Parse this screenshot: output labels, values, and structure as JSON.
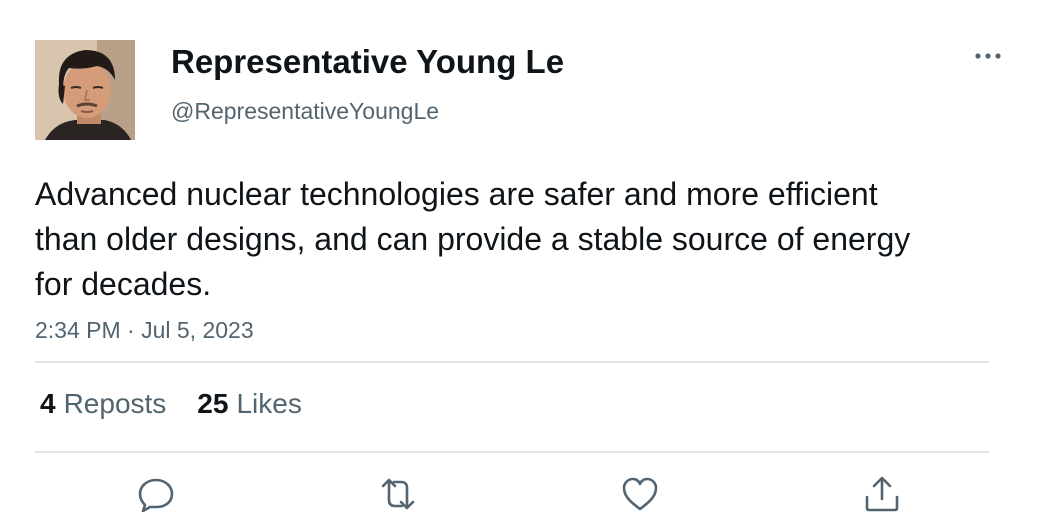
{
  "author": {
    "display_name": "Representative Young Le",
    "handle": "@RepresentativeYoungLe",
    "avatar_icon": "profile-photo"
  },
  "post": {
    "text": "Advanced nuclear technologies are safer and more efficient than older designs, and can provide a stable source of energy for decades.",
    "timestamp": "2:34 PM · Jul 5, 2023"
  },
  "stats": {
    "reposts_count": "4",
    "reposts_label": "Reposts",
    "likes_count": "25",
    "likes_label": "Likes"
  },
  "actions": [
    {
      "icon": "reply-icon"
    },
    {
      "icon": "repost-icon"
    },
    {
      "icon": "like-icon"
    },
    {
      "icon": "share-icon"
    }
  ],
  "colors": {
    "text_primary": "#0f1419",
    "text_secondary": "#536471",
    "divider": "#e3e6e9",
    "icon": "#536471"
  }
}
